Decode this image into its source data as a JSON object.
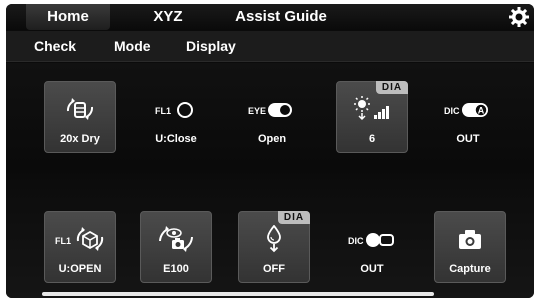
{
  "header": {
    "tabs": [
      {
        "label": "Home"
      },
      {
        "label": "XYZ"
      },
      {
        "label": "Assist Guide"
      }
    ]
  },
  "subtabs": [
    {
      "label": "Check"
    },
    {
      "label": "Mode"
    },
    {
      "label": "Display"
    }
  ],
  "row1": [
    {
      "label": "20x Dry",
      "icon": "objective-icon"
    },
    {
      "label": "U:Close",
      "prefix": "FL1",
      "icon": "shutter-closed-icon"
    },
    {
      "label": "Open",
      "prefix": "EYE",
      "icon": "toggle-on-icon"
    },
    {
      "label": "6",
      "badge": "DIA",
      "icon": "brightness-icon"
    },
    {
      "label": "OUT",
      "prefix": "DIC",
      "icon": "dic-analyzer-icon"
    }
  ],
  "row2": [
    {
      "label": "U:OPEN",
      "prefix": "FL1",
      "icon": "filter-cube-icon"
    },
    {
      "label": "E100",
      "icon": "eye-camera-switch-icon"
    },
    {
      "label": "OFF",
      "badge": "DIA",
      "icon": "condenser-drop-icon"
    },
    {
      "label": "OUT",
      "prefix": "DIC",
      "icon": "dic-slider-icon"
    },
    {
      "label": "Capture",
      "icon": "camera-icon"
    }
  ]
}
